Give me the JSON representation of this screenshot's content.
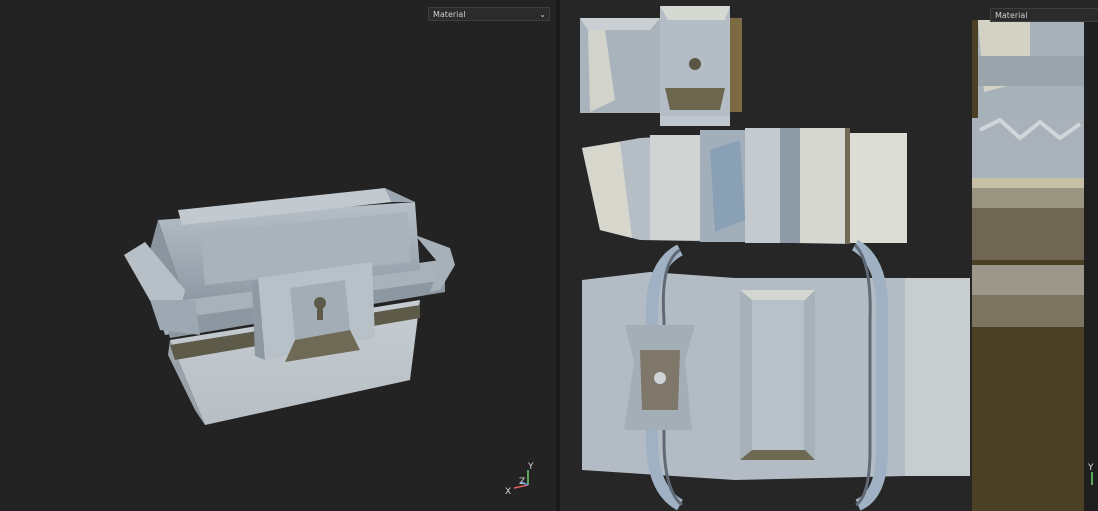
{
  "left_viewport": {
    "material_dropdown": {
      "selected": "Material"
    },
    "axis_gizmo": {
      "x_label": "X",
      "y_label": "Y",
      "z_label": "Z"
    }
  },
  "right_viewport": {
    "material_dropdown": {
      "selected": "Material"
    },
    "axis_gizmo": {
      "y_label": "Y"
    }
  },
  "colors": {
    "background": "#232323",
    "mesh_base": "#aab4bd",
    "mesh_shadow": "#6d6650",
    "uv_dark": "#4a3f23",
    "dropdown_bg": "#2b2b2b"
  },
  "icons": [
    "chevron-down-icon",
    "axis-gizmo-icon"
  ]
}
